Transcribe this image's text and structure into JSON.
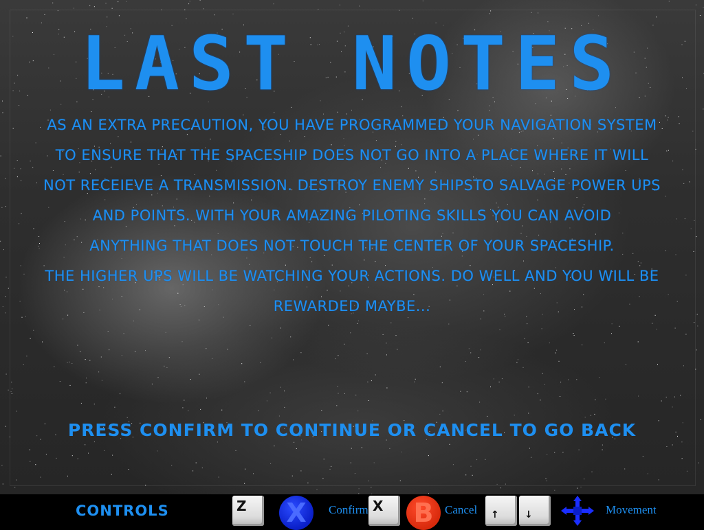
{
  "screen": {
    "title": "LAST NOTES",
    "story_lines": [
      "AS AN EXTRA PRECAUTION, YOU HAVE PROGRAMMED YOUR NAVIGATION SYSTEM",
      "TO ENSURE THAT THE SPACESHIP DOES NOT GO INTO A PLACE WHERE IT WILL",
      "NOT RECEIEVE A TRANSMISSION. DESTROY ENEMY SHIPSTO SALVAGE POWER UPS",
      "AND POINTS. WITH YOUR AMAZING PILOTING SKILLS YOU CAN AVOID",
      "ANYTHING THAT DOES NOT TOUCH THE CENTER OF YOUR SPACESHIP.",
      "THE HIGHER UPS WILL BE WATCHING YOUR ACTIONS. DO WELL AND YOU WILL BE",
      "REWARDED MAYBE..."
    ],
    "prompt": "PRESS CONFIRM TO CONTINUE OR CANCEL TO GO BACK"
  },
  "controls": {
    "title": "CONTROLS",
    "confirm_key": "Z",
    "confirm_button": "X",
    "confirm_label": "Confirm",
    "cancel_key": "X",
    "cancel_button": "B",
    "cancel_label": "Cancel",
    "up_key": "↑",
    "down_key": "↓",
    "movement_label": "Movement"
  },
  "colors": {
    "text_accent": "#1e8ff0",
    "button_x": "#1030e0",
    "button_b": "#e8401c"
  }
}
